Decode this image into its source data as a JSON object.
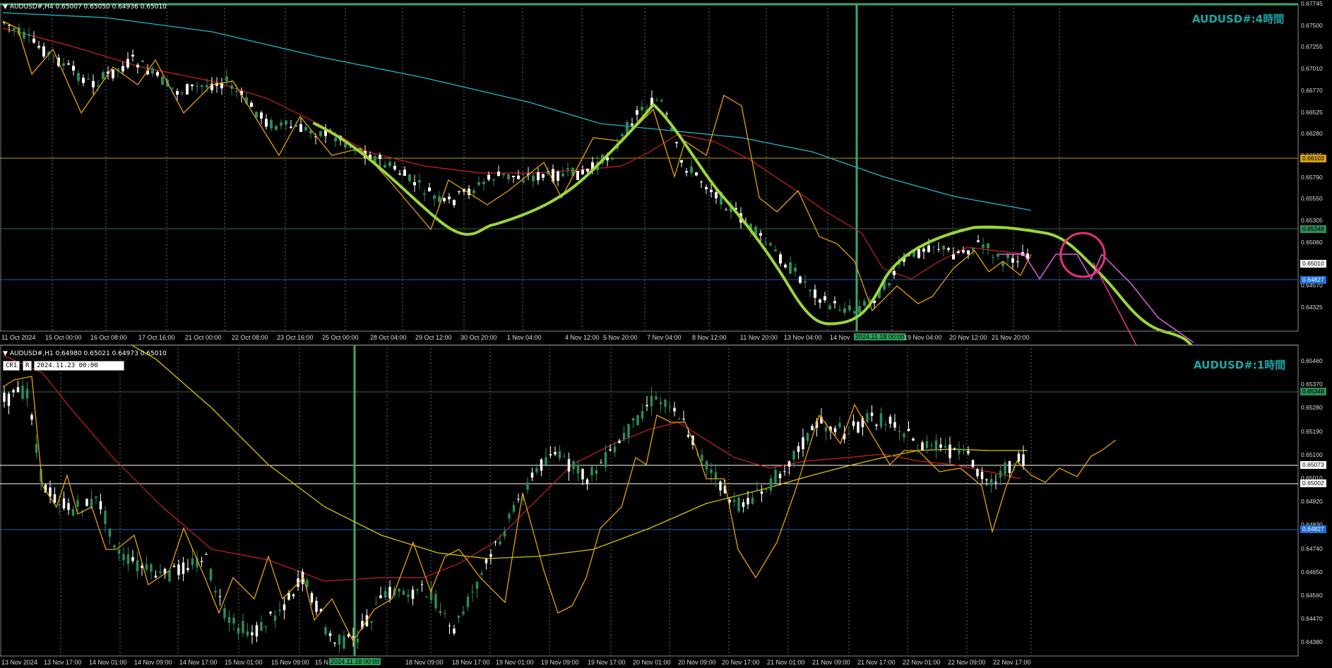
{
  "top_chart": {
    "header": "AUDUSD#,H4  0.65007 0.65050 0.64936 0.65010",
    "watermark": "AUDUSD#:4時間",
    "price_labels": [
      "0.67745",
      "0.67500",
      "0.67255",
      "0.67010",
      "0.66770",
      "0.66525",
      "0.66280",
      "0.66035",
      "0.65790",
      "0.65550",
      "0.65305",
      "0.65060",
      "0.64815",
      "0.64570",
      "0.64325"
    ],
    "hlines": [
      {
        "value": "0.66103",
        "color": "#d4a017",
        "text": "#000"
      },
      {
        "value": "0.65348",
        "color": "#2e8b57",
        "text": "#000"
      },
      {
        "value": "0.65010",
        "color": "#ffffff",
        "text": "#000"
      },
      {
        "value": "0.64827",
        "color": "#1e6fd9",
        "text": "#fff"
      }
    ],
    "time_labels": [
      "11 Oct 2024",
      "15 Oct 00:00",
      "16 Oct 08:00",
      "17 Oct 16:00",
      "21 Oct 00:00",
      "22 Oct 08:00",
      "23 Oct 16:00",
      "25 Oct 00:00",
      "28 Oct 04:00",
      "29 Oct 12:00",
      "30 Oct 20:00",
      "1 Nov 04:00",
      "4 Nov 12:00",
      "5 Nov 20:00",
      "7 Nov 04:00",
      "8 Nov 12:00",
      "11 Nov 20:00",
      "13 Nov 04:00",
      "14 Nov",
      "2024.11.18 00:00",
      "19 Nov 04:00",
      "20 Nov 12:00",
      "21 Nov 20:00"
    ]
  },
  "bottom_chart": {
    "header": "AUDUSD#,H1  0.64980 0.65021 0.64973 0.65010",
    "crosshair_box": "CR1",
    "crosshair_r": "R",
    "crosshair_date": "2024.11.23 00:00",
    "watermark": "AUDUSD#:1時間",
    "price_labels": [
      "0.65460",
      "0.65370",
      "0.65280",
      "0.65190",
      "0.65100",
      "0.65010",
      "0.64920",
      "0.64830",
      "0.64740",
      "0.64650",
      "0.64560",
      "0.64470",
      "0.64380"
    ],
    "hlines": [
      {
        "value": "0.65348",
        "color": "#2e8b57",
        "text": "#000"
      },
      {
        "value": "0.65073",
        "color": "#ffffff",
        "text": "#000"
      },
      {
        "value": "0.65002",
        "color": "#ffffff",
        "text": "#000"
      },
      {
        "value": "0.64827",
        "color": "#1e6fd9",
        "text": "#fff"
      }
    ],
    "time_labels": [
      "13 Nov 2024",
      "13 Nov 17:00",
      "14 Nov 01:00",
      "14 Nov 09:00",
      "14 Nov 17:00",
      "15 Nov 01:00",
      "15 Nov 09:00",
      "15 N",
      "2024.11.18 00:00",
      "18 Nov 09:00",
      "18 Nov 17:00",
      "19 Nov 01:00",
      "19 Nov 09:00",
      "19 Nov 17:00",
      "20 Nov 01:00",
      "20 Nov 09:00",
      "20 Nov 17:00",
      "21 Nov 01:00",
      "21 Nov 09:00",
      "21 Nov 17:00",
      "22 Nov 01:00",
      "22 Nov 09:00",
      "22 Nov 17:00"
    ]
  },
  "colors": {
    "bull": "#2e8b57",
    "bear": "#ffffff",
    "zigzag": "#e8a200",
    "ma_fast": "#cc2222",
    "ma_slow_top": "#22b8c8",
    "ma_slow_bottom": "#d8c400",
    "drawing": "#9ad63a",
    "marker": "#e8317a",
    "projection": "#e060e0"
  }
}
